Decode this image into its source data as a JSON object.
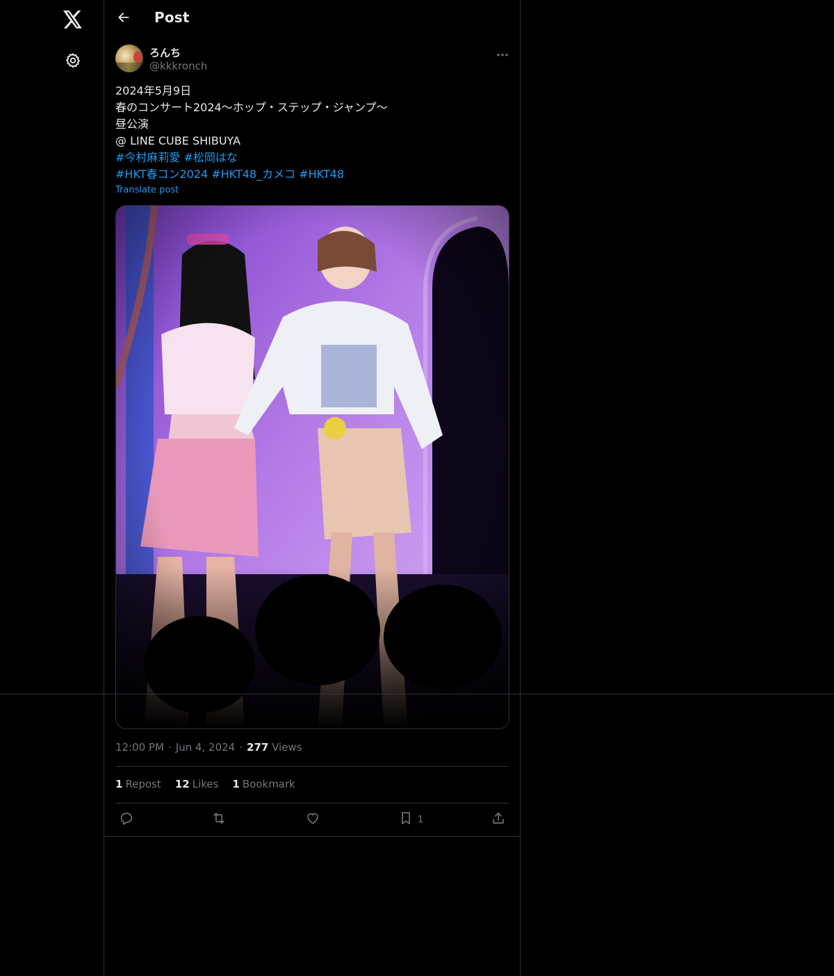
{
  "nav": {
    "logo_icon": "x-logo-icon",
    "settings_icon": "gear-icon"
  },
  "header": {
    "back_icon": "arrow-left-icon",
    "title": "Post"
  },
  "author": {
    "name": "ろんち",
    "handle": "@kkkronch"
  },
  "tweet": {
    "lines": [
      "2024年5月9日",
      "春のコンサート2024〜ホップ・ステップ・ジャンプ〜",
      "昼公演",
      "@ LINE CUBE SHIBUYA"
    ],
    "hashtags_row1": [
      "#今村麻莉愛",
      "#松岡はな"
    ],
    "hashtags_row2": [
      "#HKT春コン2024",
      "#HKT48_カメコ",
      "#HKT48"
    ],
    "translate": "Translate post"
  },
  "meta": {
    "time": "12:00 PM",
    "date": "Jun 4, 2024",
    "views_count": "277",
    "views_label": "Views"
  },
  "stats": {
    "reposts_count": "1",
    "reposts_label": "Repost",
    "likes_count": "12",
    "likes_label": "Likes",
    "bookmarks_count": "1",
    "bookmarks_label": "Bookmark"
  },
  "actions": {
    "bookmark_count": "1"
  },
  "colors": {
    "background": "#000000",
    "text": "#e7e9ea",
    "muted": "#71767b",
    "accent": "#1d9bf0",
    "border": "#2f3336"
  }
}
